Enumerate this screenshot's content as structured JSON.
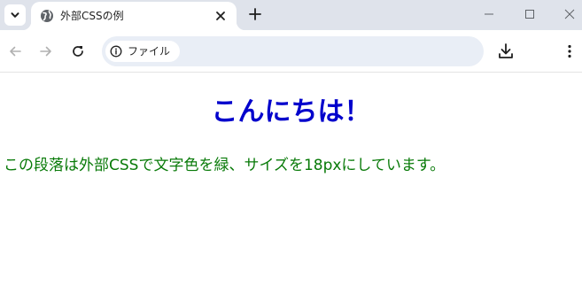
{
  "tab": {
    "title": "外部CSSの例"
  },
  "omnibox": {
    "security_chip_label": "ファイル"
  },
  "content": {
    "heading": "こんにちは！",
    "paragraph": "この段落は外部CSSで文字色を緑、サイズを18pxにしています。"
  },
  "colors": {
    "heading": "#0000cc",
    "paragraph": "#087a08",
    "tabstrip": "#dfe3eb",
    "omnibox": "#e9eef6"
  }
}
